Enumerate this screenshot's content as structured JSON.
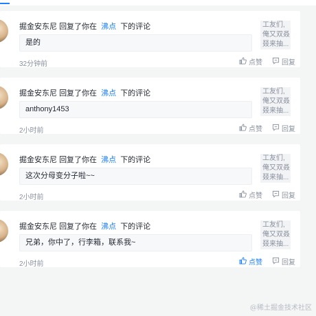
{
  "notifications": [
    {
      "user": "掘金安东尼",
      "action_text": "回复了你在",
      "link_text": "沸点",
      "after_text": "下的评论",
      "reply": "是的",
      "time": "32分钟前",
      "thumb_lines": [
        "工友们,",
        "俺又双叒",
        "叕来抽..."
      ],
      "like_label": "点赞",
      "reply_label": "回复",
      "liked": false
    },
    {
      "user": "掘金安东尼",
      "action_text": "回复了你在",
      "link_text": "沸点",
      "after_text": "下的评论",
      "reply": "anthony1453",
      "time": "2小时前",
      "thumb_lines": [
        "工友们,",
        "俺又双叒",
        "叕来抽..."
      ],
      "like_label": "点赞",
      "reply_label": "回复",
      "liked": false
    },
    {
      "user": "掘金安东尼",
      "action_text": "回复了你在",
      "link_text": "沸点",
      "after_text": "下的评论",
      "reply": "这次分母变分子啦~~",
      "time": "2小时前",
      "thumb_lines": [
        "工友们,",
        "俺又双叒",
        "叕来抽..."
      ],
      "like_label": "点赞",
      "reply_label": "回复",
      "liked": false
    },
    {
      "user": "掘金安东尼",
      "action_text": "回复了你在",
      "link_text": "沸点",
      "after_text": "下的评论",
      "reply": "兄弟，你中了，行李箱，联系我~",
      "time": "2小时前",
      "thumb_lines": [
        "工友们,",
        "俺又双叒",
        "叕来抽..."
      ],
      "like_label": "点赞",
      "reply_label": "回复",
      "liked": true
    }
  ],
  "colors": {
    "accent": "#1e80ff",
    "muted": "#8a919f",
    "text": "#252933"
  },
  "watermark": "@稀土掘金技术社区"
}
